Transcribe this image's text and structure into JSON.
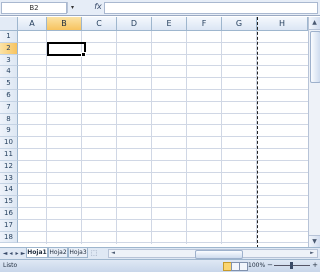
{
  "formula_bar": {
    "name_box": "B2",
    "dropdown_icon": "chevron-down-icon",
    "function_icon": "fx-icon",
    "formula_value": ""
  },
  "columns": [
    "A",
    "B",
    "C",
    "D",
    "E",
    "F",
    "G",
    "H"
  ],
  "selected_column": "B",
  "rows": [
    "1",
    "2",
    "3",
    "4",
    "5",
    "6",
    "7",
    "8",
    "9",
    "10",
    "11",
    "12",
    "13",
    "14",
    "15",
    "16",
    "17",
    "18"
  ],
  "selected_row": "2",
  "sheets": {
    "tabs": [
      "Hoja1",
      "Hoja2",
      "Hoja3"
    ],
    "active": "Hoja1",
    "nav_icons": [
      "first-sheet-icon",
      "prev-sheet-icon",
      "next-sheet-icon",
      "last-sheet-icon"
    ],
    "new_sheet_icon": "insert-sheet-icon"
  },
  "status": {
    "mode": "Listo",
    "zoom": "100%",
    "zoom_minus": "−",
    "zoom_plus": "+"
  },
  "colors": {
    "selected_header": "#f7c35f",
    "grid_line": "#d0d7e5",
    "header_bg": "#dce6f4"
  }
}
